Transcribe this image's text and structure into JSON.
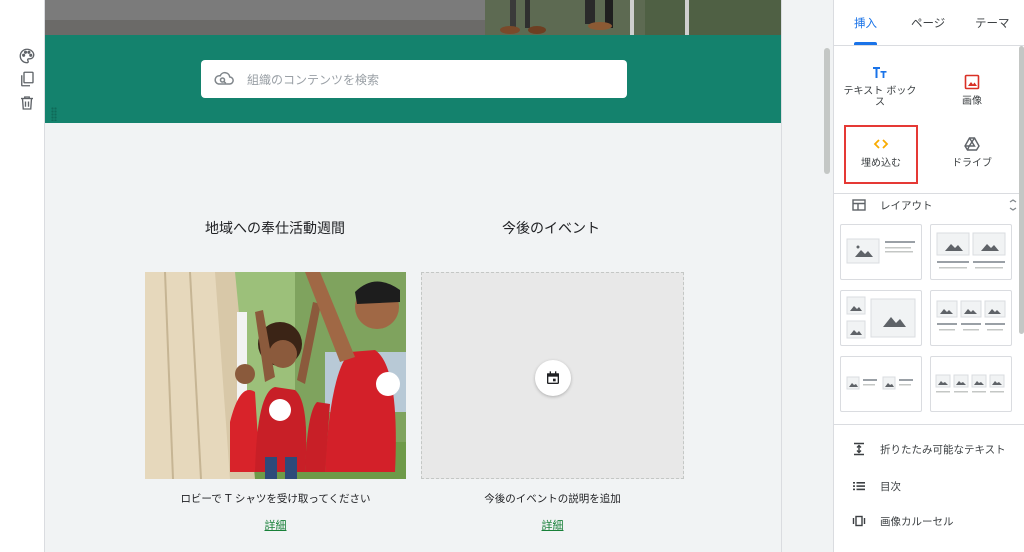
{
  "canvas": {
    "search_placeholder": "組織のコンテンツを検索",
    "sections": [
      {
        "title": "地域への奉仕活動週間",
        "caption": "ロビーで T シャツを受け取ってください",
        "link": "詳細"
      },
      {
        "title": "今後のイベント",
        "caption": "今後のイベントの説明を追加",
        "link": "詳細"
      }
    ]
  },
  "panel": {
    "tabs": [
      {
        "label": "挿入",
        "active": true
      },
      {
        "label": "ページ",
        "active": false
      },
      {
        "label": "テーマ",
        "active": false
      }
    ],
    "insert_items": [
      {
        "label": "テキスト ボックス",
        "icon": "text-box-icon"
      },
      {
        "label": "画像",
        "icon": "image-icon"
      },
      {
        "label": "埋め込む",
        "icon": "embed-code-icon"
      },
      {
        "label": "ドライブ",
        "icon": "drive-icon"
      }
    ],
    "layout_label": "レイアウト",
    "tools": [
      {
        "label": "折りたたみ可能なテキスト",
        "icon": "collapsible-text-icon"
      },
      {
        "label": "目次",
        "icon": "table-of-contents-icon"
      },
      {
        "label": "画像カルーセル",
        "icon": "image-carousel-icon"
      }
    ]
  },
  "colors": {
    "teal": "#14826d",
    "accent": "#1a73e8",
    "link": "#188038",
    "highlight": "#e53935"
  }
}
